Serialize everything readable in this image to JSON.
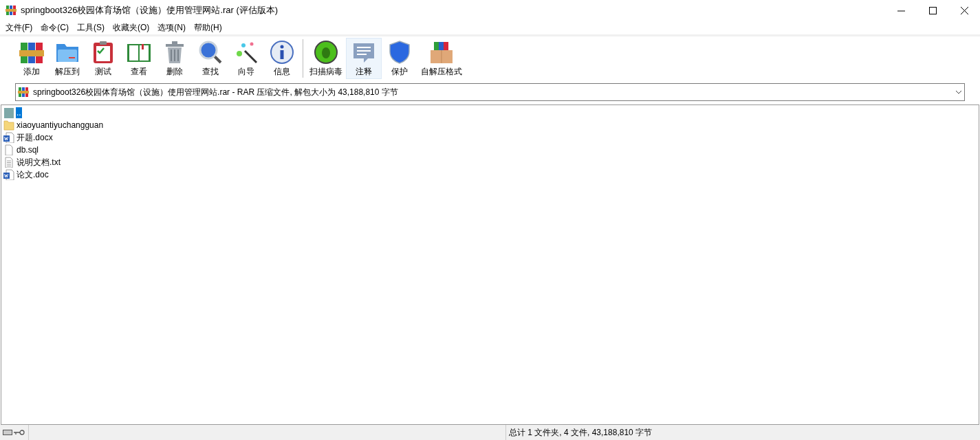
{
  "window": {
    "title": "springboot326校园体育场馆（设施）使用管理网站.rar (评估版本)"
  },
  "menu": [
    "文件(F)",
    "命令(C)",
    "工具(S)",
    "收藏夹(O)",
    "选项(N)",
    "帮助(H)"
  ],
  "toolbar": [
    {
      "kind": "add",
      "label": "添加",
      "highlighted": false
    },
    {
      "kind": "extract",
      "label": "解压到",
      "highlighted": false
    },
    {
      "kind": "test",
      "label": "测试",
      "highlighted": false
    },
    {
      "kind": "view",
      "label": "查看",
      "highlighted": false
    },
    {
      "kind": "delete",
      "label": "删除",
      "highlighted": false
    },
    {
      "kind": "find",
      "label": "查找",
      "highlighted": false
    },
    {
      "kind": "wizard",
      "label": "向导",
      "highlighted": false
    },
    {
      "kind": "info",
      "label": "信息",
      "highlighted": false
    },
    {
      "kind": "separator"
    },
    {
      "kind": "virus",
      "label": "扫描病毒",
      "highlighted": false
    },
    {
      "kind": "comment",
      "label": "注释",
      "highlighted": true
    },
    {
      "kind": "protect",
      "label": "保护",
      "highlighted": false
    },
    {
      "kind": "sfx",
      "label": "自解压格式",
      "highlighted": false
    }
  ],
  "path_bar": {
    "text": "springboot326校园体育场馆（设施）使用管理网站.rar - RAR 压缩文件, 解包大小为 43,188,810 字节"
  },
  "files": [
    {
      "kind": "parent",
      "name": "..",
      "selected": true
    },
    {
      "kind": "folder",
      "name": "xiaoyuantiyuchangguan",
      "selected": false
    },
    {
      "kind": "word",
      "name": "开题.docx",
      "selected": false
    },
    {
      "kind": "file",
      "name": "db.sql",
      "selected": false
    },
    {
      "kind": "text",
      "name": "说明文档.txt",
      "selected": false
    },
    {
      "kind": "word",
      "name": "论文.doc",
      "selected": false
    }
  ],
  "status_bar": {
    "summary": "总计 1 文件夹, 4 文件, 43,188,810 字节"
  }
}
